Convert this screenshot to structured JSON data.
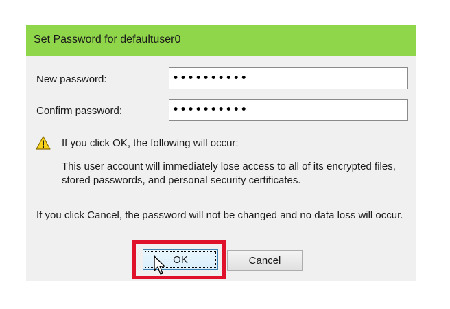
{
  "dialog": {
    "title": "Set Password for defaultuser0",
    "new_password": {
      "label": "New password:",
      "value": "••••••••••"
    },
    "confirm_password": {
      "label": "Confirm password:",
      "value": "••••••••••"
    },
    "warning": {
      "icon": "warning-icon",
      "heading": "If you click OK, the following will occur:",
      "body": "This user account will immediately lose access to all of its encrypted files, stored passwords, and personal security certificates."
    },
    "cancel_note": "If you click Cancel, the password will not be changed and no data loss will occur.",
    "buttons": {
      "ok_label": "OK",
      "cancel_label": "Cancel"
    }
  },
  "colors": {
    "titlebar": "#8fd64a",
    "dialog_bg": "#f0f0f0",
    "highlight": "#e0112b",
    "warning_yellow": "#f7d21c"
  }
}
